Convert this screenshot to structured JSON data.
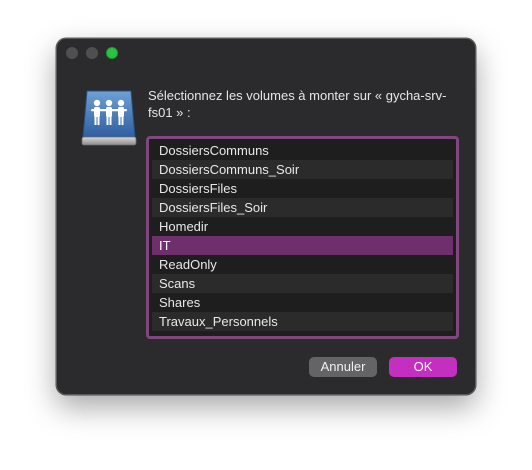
{
  "dialog": {
    "prompt": "Sélectionnez les volumes à monter sur « gycha-srv-fs01 » :",
    "icon": "shared-server-icon"
  },
  "volumes": [
    {
      "label": "DossiersCommuns",
      "selected": false
    },
    {
      "label": "DossiersCommuns_Soir",
      "selected": false
    },
    {
      "label": "DossiersFiles",
      "selected": false
    },
    {
      "label": "DossiersFiles_Soir",
      "selected": false
    },
    {
      "label": "Homedir",
      "selected": false
    },
    {
      "label": "IT",
      "selected": true
    },
    {
      "label": "ReadOnly",
      "selected": false
    },
    {
      "label": "Scans",
      "selected": false
    },
    {
      "label": "Shares",
      "selected": false
    },
    {
      "label": "Travaux_Personnels",
      "selected": false
    }
  ],
  "buttons": {
    "cancel_label": "Annuler",
    "ok_label": "OK"
  },
  "colors": {
    "accent": "#c42fc1",
    "selection": "#6e2f6c",
    "focus_ring": "#80477e",
    "window_bg": "#2b2b2d"
  }
}
